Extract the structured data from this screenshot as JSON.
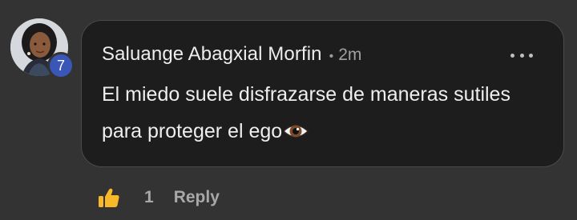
{
  "comment": {
    "author": "Saluange Abagxial Morfin",
    "separator": "•",
    "time": "2m",
    "text": "El miedo suele disfrazarse de maneras sutiles para proteger el ego",
    "badge_count": "7",
    "trailing_emoji": "eye-icon"
  },
  "actions": {
    "like_count": "1",
    "reply_label": "Reply"
  },
  "colors": {
    "background": "#333333",
    "bubble": "#1d1d1d",
    "badge": "#3a56b6",
    "like_icon": "#f7b928"
  }
}
